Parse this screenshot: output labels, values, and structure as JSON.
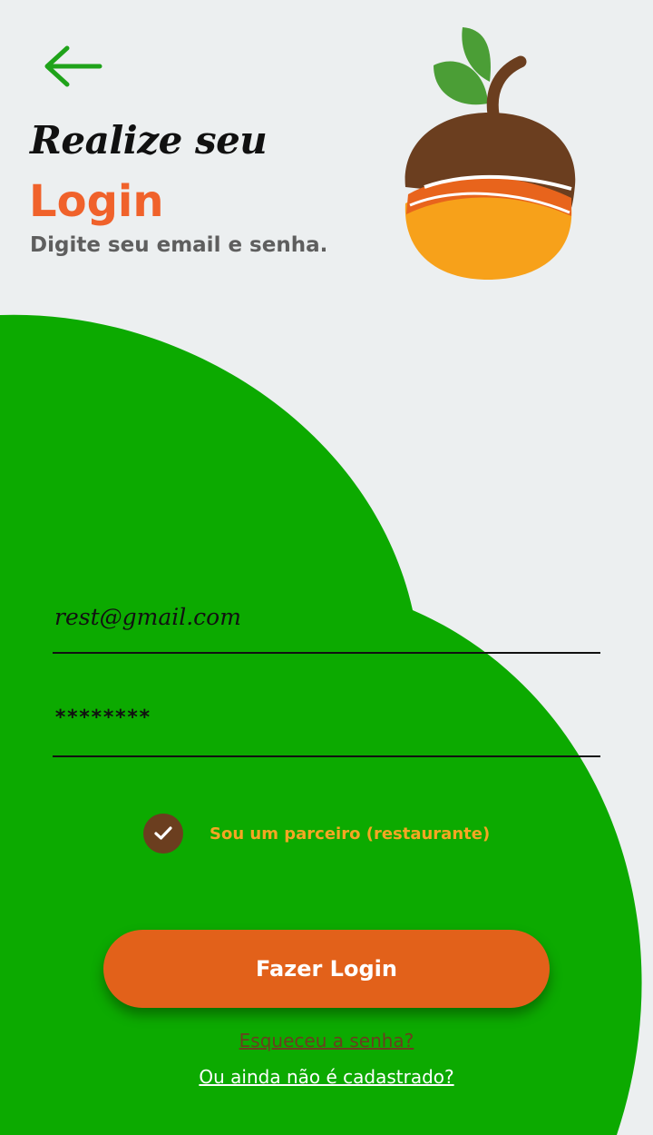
{
  "colors": {
    "background": "#eceff0",
    "green": "#0caa00",
    "accent_orange": "#f0622b",
    "button_orange": "#e2611a",
    "brown": "#6b3e1f",
    "partner_yellow": "#f5a623"
  },
  "header": {
    "back_icon": "arrow-left-icon",
    "title_line1": "Realize seu",
    "title_line2": "Login",
    "subtitle": "Digite seu email e senha."
  },
  "form": {
    "email_value": "rest@gmail.com",
    "password_value": "********",
    "partner_checked": true,
    "partner_label": "Sou um parceiro (restaurante)",
    "check_icon": "check-icon"
  },
  "actions": {
    "login_label": "Fazer Login",
    "forgot_label": "Esqueceu a senha?",
    "signup_label": "Ou ainda não é cadastrado?"
  }
}
